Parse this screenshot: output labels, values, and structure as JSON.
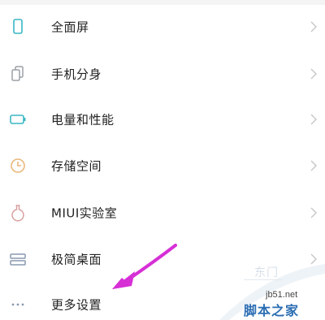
{
  "settings": {
    "items": [
      {
        "label": "全面屏",
        "icon": "phone-icon"
      },
      {
        "label": "手机分身",
        "icon": "dual-phone-icon"
      },
      {
        "label": "电量和性能",
        "icon": "battery-icon"
      },
      {
        "label": "存储空间",
        "icon": "storage-clock-icon"
      },
      {
        "label": "MIUI实验室",
        "icon": "flask-icon"
      },
      {
        "label": "极简桌面",
        "icon": "simple-desktop-icon"
      },
      {
        "label": "更多设置",
        "icon": "more-dots-icon"
      }
    ]
  },
  "watermark": {
    "faint_text": "东门",
    "site": "jb51.net",
    "brand": "脚本之家"
  },
  "colors": {
    "icon_teal": "#3ab7c4",
    "icon_gray": "#9aa0a6",
    "icon_orange": "#e8b87a",
    "icon_pink": "#d9a0a0",
    "icon_blue_gray": "#8a9ab0",
    "chevron": "#c6c6c6",
    "arrow_magenta": "#d62fd6",
    "brand_blue": "#2b6db3"
  }
}
